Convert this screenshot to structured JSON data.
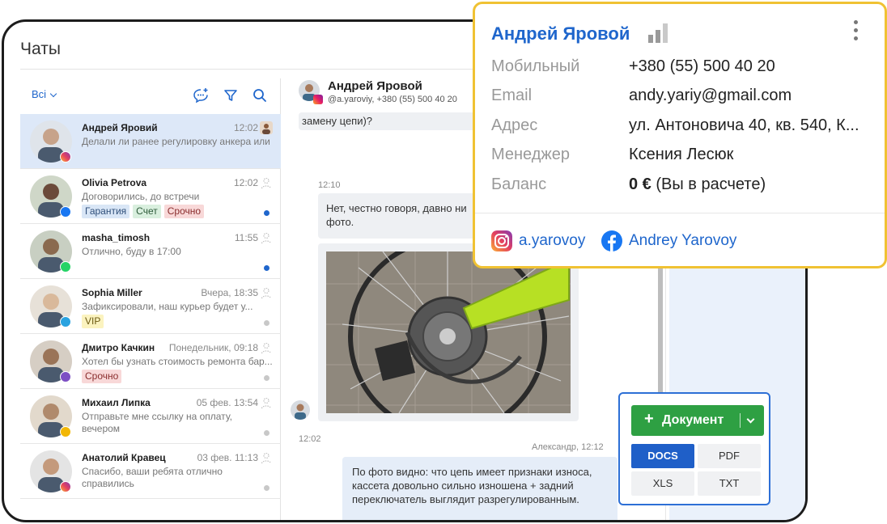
{
  "app": {
    "title": "Чаты"
  },
  "sidebar": {
    "filter_label": "Всі",
    "icons": [
      "new-chat-icon",
      "filter-icon",
      "search-icon"
    ],
    "chats": [
      {
        "name": "Андрей Яровий",
        "time": "12:02",
        "preview": "Делали ли ранее регулировку анкера или",
        "channel": "instagram",
        "tags": [],
        "active": true,
        "unread": false,
        "agent": "assigned-agent-avatar"
      },
      {
        "name": "Olivia Petrova",
        "time": "12:02",
        "preview": "Договорились, до встречи",
        "channel": "facebook",
        "tags": [
          {
            "label": "Гарантия",
            "color": "blue"
          },
          {
            "label": "Счет",
            "color": "green"
          },
          {
            "label": "Срочно",
            "color": "red"
          }
        ],
        "active": false,
        "unread": true,
        "agent": "unassigned-icon"
      },
      {
        "name": "masha_timosh",
        "time": "11:55",
        "preview": "Отлично, буду в 17:00",
        "channel": "whatsapp",
        "tags": [],
        "active": false,
        "unread": true,
        "agent": "unassigned-icon"
      },
      {
        "name": "Sophia Miller",
        "time": "Вчера, 18:35",
        "preview": "Зафиксировали, наш курьер будет у...",
        "channel": "telegram",
        "tags": [
          {
            "label": "VIP",
            "color": "yellow"
          }
        ],
        "active": false,
        "unread": false,
        "agent": "unassigned-icon"
      },
      {
        "name": "Дмитро Качкин",
        "time": "Понедельник, 09:18",
        "preview": "Хотел бы узнать стоимость ремонта бар...",
        "channel": "viber",
        "tags": [
          {
            "label": "Срочно",
            "color": "red"
          }
        ],
        "active": false,
        "unread": false,
        "agent": "unassigned-icon"
      },
      {
        "name": "Михаил Липка",
        "time": "05 фев. 13:54",
        "preview": "Отправьте мне ссылку на оплату, вечером",
        "channel": "other",
        "tags": [],
        "active": false,
        "unread": false,
        "agent": "unassigned-icon"
      },
      {
        "name": "Анатолий Кравец",
        "time": "03 фев. 11:13",
        "preview": "Спасибо, ваши ребята отлично справились",
        "channel": "instagram",
        "tags": [],
        "active": false,
        "unread": false,
        "agent": "unassigned-icon"
      }
    ]
  },
  "conversation": {
    "header": {
      "name": "Андрей Яровой",
      "subtitle": "@a.yaroviy, +380 (55) 500 40 20"
    },
    "messages": [
      {
        "text": "замену цепи)?",
        "time": ""
      },
      {
        "text": "Нет, честно говоря, давно ни фото.",
        "time": "12:10"
      },
      {
        "text": "По фото видно: что цепь имеет признаки износа, кассета довольно сильно изношена + задний переключатель выглядит разрегулированным.",
        "time": "12:02",
        "author_time": "Александр, 12:12"
      }
    ],
    "photo_alt": "bicycle-rear-derailleur-photo"
  },
  "doc_widget": {
    "main_label": "Документ",
    "formats": [
      {
        "label": "DOCS",
        "selected": true
      },
      {
        "label": "PDF",
        "selected": false
      },
      {
        "label": "XLS",
        "selected": false
      },
      {
        "label": "TXT",
        "selected": false
      }
    ]
  },
  "contact": {
    "name": "Андрей Яровой",
    "fields": [
      {
        "label": "Мобильный",
        "value": "+380 (55) 500 40 20"
      },
      {
        "label": "Email",
        "value": "andy.yariy@gmail.com"
      },
      {
        "label": "Адрес",
        "value": "ул. Антоновича 40, кв. 540, К..."
      },
      {
        "label": "Менеджер",
        "value": "Ксения Лесюк"
      }
    ],
    "balance": {
      "label": "Баланс",
      "amount": "0 €",
      "note": " (Вы в расчете)"
    },
    "socials": [
      {
        "network": "instagram",
        "handle": "a.yarovoy"
      },
      {
        "network": "facebook",
        "handle": "Andrey Yarovoy"
      }
    ]
  },
  "colors": {
    "accent": "#1f66cc",
    "card_border": "#f0c233",
    "doc_button": "#2ea043",
    "format_selected": "#1f5fc8",
    "unread_dot": "#1f66cc"
  }
}
